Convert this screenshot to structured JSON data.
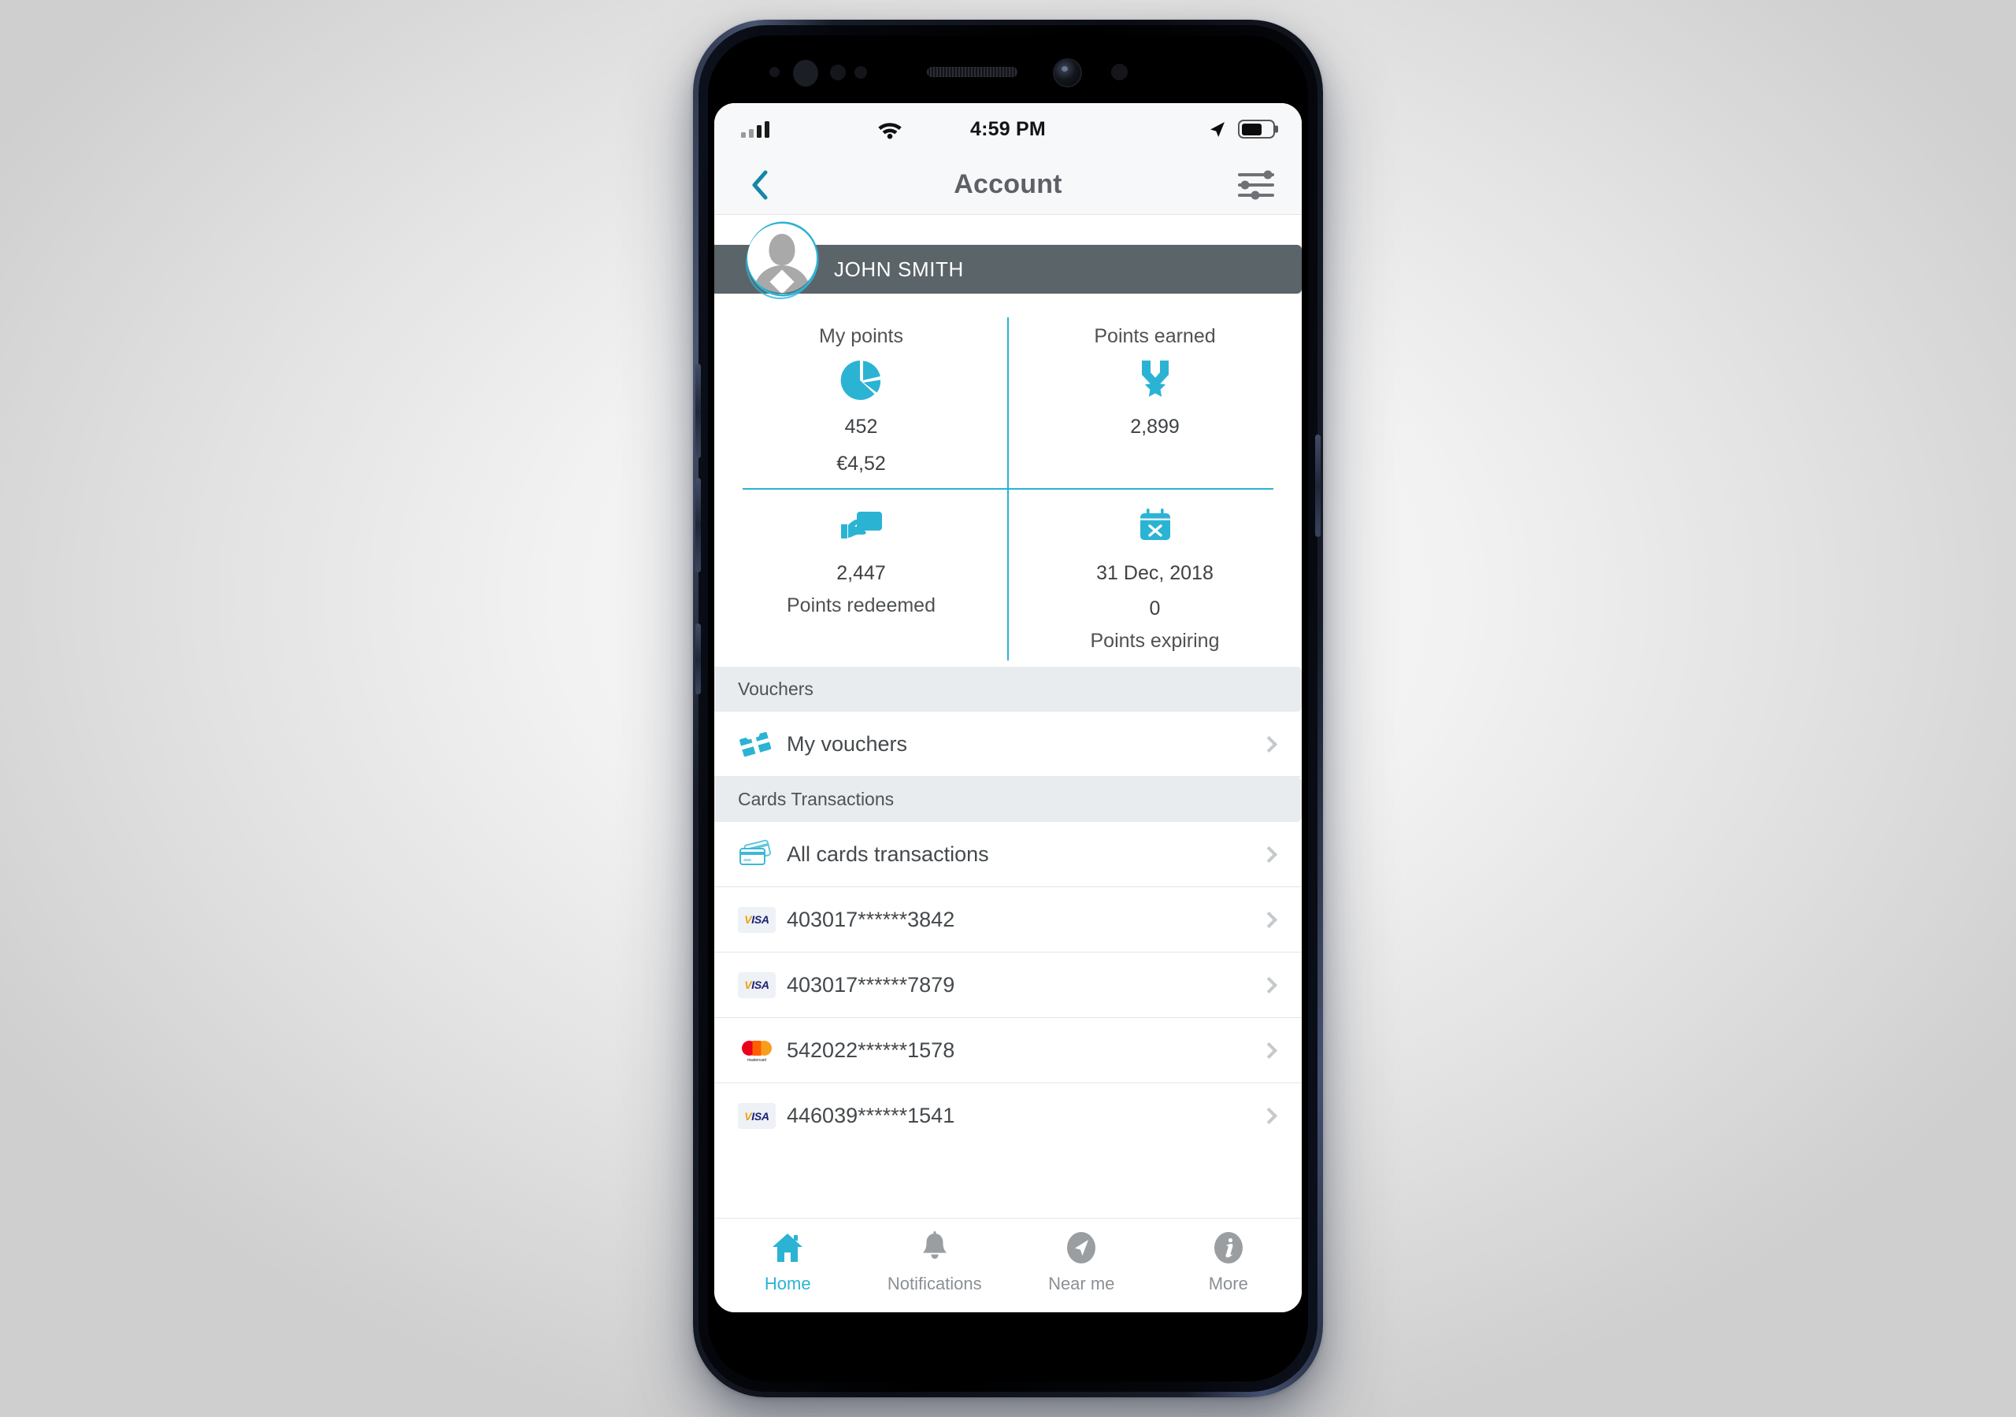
{
  "theme": {
    "accent": "#2bb3d4",
    "banner_bg": "#5b6468",
    "section_bg": "#e8ecee",
    "text_dark": "#45494c",
    "text_muted": "#8b9094"
  },
  "status_bar": {
    "time": "4:59 PM",
    "signal_icon": "signal-bars-icon",
    "wifi_icon": "wifi-icon",
    "location_icon": "location-arrow-icon",
    "battery_icon": "battery-icon",
    "battery_level": 68
  },
  "header": {
    "title": "Account",
    "back_icon": "chevron-left-icon",
    "filter_icon": "sliders-icon"
  },
  "profile": {
    "name": "JOHN SMITH",
    "avatar_icon": "user-avatar-icon"
  },
  "points": {
    "cells": [
      {
        "label": "My points",
        "label_position": "top",
        "icon": "pie-chart-icon",
        "value": "452",
        "sub": "€4,52"
      },
      {
        "label": "Points earned",
        "label_position": "top",
        "icon": "medal-icon",
        "value": "2,899",
        "sub": ""
      },
      {
        "label": "Points redeemed",
        "label_position": "bottom",
        "icon": "hand-card-icon",
        "value": "2,447",
        "sub": ""
      },
      {
        "label": "Points expiring",
        "label_position": "bottom",
        "icon": "calendar-x-icon",
        "value": "31 Dec, 2018",
        "sub": "0"
      }
    ]
  },
  "sections": [
    {
      "title": "Vouchers",
      "rows": [
        {
          "label": "My vouchers",
          "icon": "gift-icon",
          "logo": "none"
        }
      ]
    },
    {
      "title": "Cards Transactions",
      "rows": [
        {
          "label": "All cards transactions",
          "icon": "credit-cards-icon",
          "logo": "none"
        },
        {
          "label": "403017******3842",
          "icon": "visa-logo-icon",
          "logo": "visa"
        },
        {
          "label": "403017******7879",
          "icon": "visa-logo-icon",
          "logo": "visa"
        },
        {
          "label": "542022******1578",
          "icon": "mastercard-logo-icon",
          "logo": "mastercard"
        },
        {
          "label": "446039******1541",
          "icon": "visa-logo-icon",
          "logo": "visa"
        }
      ]
    }
  ],
  "card_brands": {
    "visa_text": "VISA",
    "mastercard_text": "mastercard"
  },
  "tabbar": {
    "items": [
      {
        "label": "Home",
        "icon": "home-icon",
        "active": true
      },
      {
        "label": "Notifications",
        "icon": "bell-icon",
        "active": false
      },
      {
        "label": "Near me",
        "icon": "navigation-arrow-icon",
        "active": false
      },
      {
        "label": "More",
        "icon": "info-circle-icon",
        "active": false
      }
    ]
  }
}
